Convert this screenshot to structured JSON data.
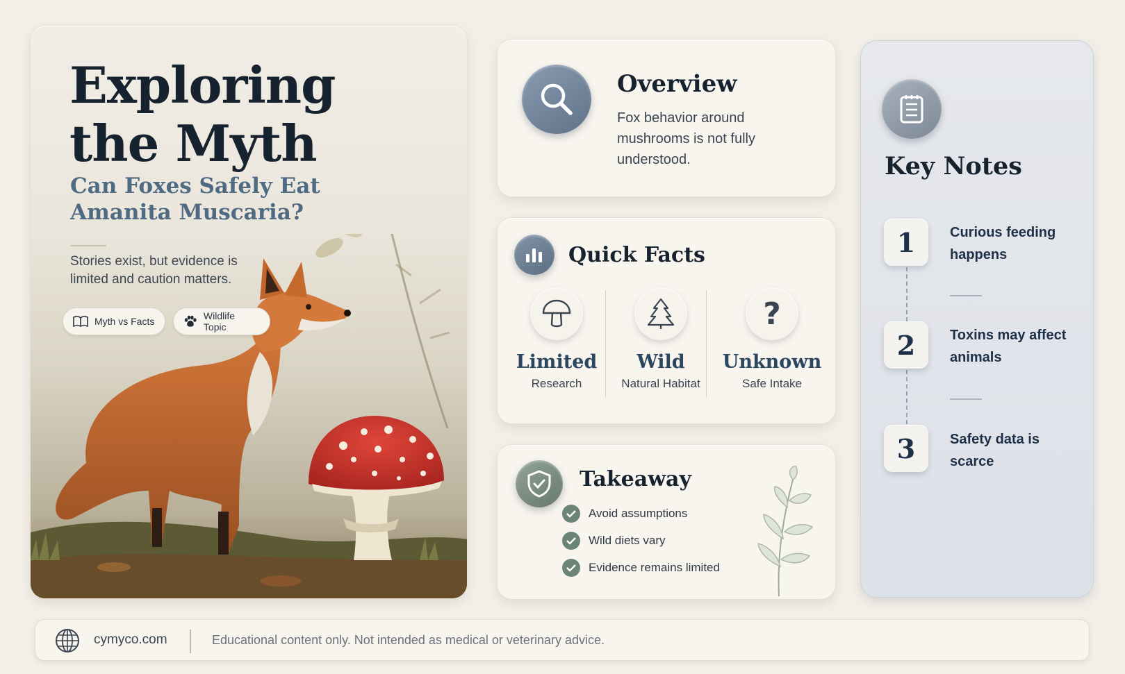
{
  "hero": {
    "title": "Exploring the Myth",
    "subtitle": "Can Foxes Safely Eat Amanita Muscaria?",
    "description": "Stories exist, but evidence is limited and caution matters.",
    "tags": [
      {
        "label": "Myth vs Facts",
        "icon": "book-icon"
      },
      {
        "label": "Wildlife Topic",
        "icon": "paw-icon"
      }
    ]
  },
  "overview": {
    "title": "Overview",
    "text": "Fox behavior around mushrooms is not fully understood.",
    "icon": "search-icon"
  },
  "quick_facts": {
    "title": "Quick Facts",
    "icon": "bar-chart-icon",
    "items": [
      {
        "value": "Limited",
        "label": "Research",
        "icon": "mushroom-icon"
      },
      {
        "value": "Wild",
        "label": "Natural Habitat",
        "icon": "tree-icon"
      },
      {
        "value": "Unknown",
        "label": "Safe Intake",
        "icon": "question-icon"
      }
    ]
  },
  "takeaway": {
    "title": "Takeaway",
    "icon": "shield-check-icon",
    "items": [
      "Avoid assumptions",
      "Wild diets vary",
      "Evidence remains limited"
    ]
  },
  "key_notes": {
    "title": "Key Notes",
    "icon": "notepad-icon",
    "items": [
      {
        "number": "1",
        "text": "Curious feeding happens"
      },
      {
        "number": "2",
        "text": "Toxins may affect animals"
      },
      {
        "number": "3",
        "text": "Safety data is scarce"
      }
    ]
  },
  "footer": {
    "site": "cymyco.com",
    "disclaimer": "Educational content only. Not intended as medical or veterinary advice.",
    "icon": "globe-icon"
  },
  "colors": {
    "background": "#f3efe8",
    "title": "#17222f",
    "subtitle": "#4f6a83",
    "accent_blue": "#5f7289",
    "accent_green": "#6b8478",
    "mushroom_red": "#c8332b",
    "fox_orange": "#c56a2d"
  }
}
